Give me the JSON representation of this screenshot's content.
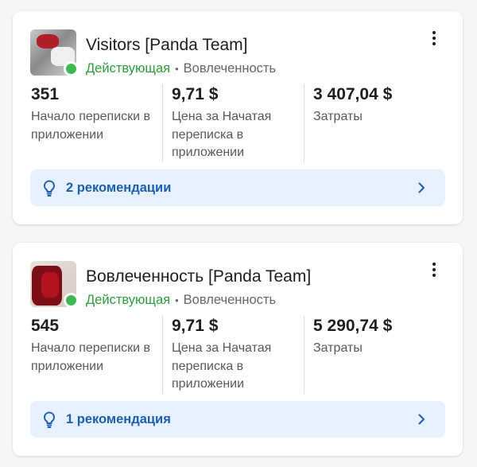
{
  "campaigns": [
    {
      "title": "Visitors [Panda Team]",
      "status": "Действующая",
      "separator": "•",
      "objective": "Вовлеченность",
      "metrics": [
        {
          "value": "351",
          "label": "Начало переписки в приложении"
        },
        {
          "value": "9,71 $",
          "label": "Цена за Начатая переписка в приложении"
        },
        {
          "value": "3 407,04 $",
          "label": "Затраты"
        }
      ],
      "recommendations": "2 рекомендации"
    },
    {
      "title": "Вовлеченность [Panda Team]",
      "status": "Действующая",
      "separator": "•",
      "objective": "Вовлеченность",
      "metrics": [
        {
          "value": "545",
          "label": "Начало переписки в приложении"
        },
        {
          "value": "9,71 $",
          "label": "Цена за Начатая переписка в приложении"
        },
        {
          "value": "5 290,74 $",
          "label": "Затраты"
        }
      ],
      "recommendations": "1 рекомендация"
    }
  ],
  "icons": {
    "thumbnail": "campaign-thumbnail",
    "status": "active-status-dot",
    "menu": "more-vertical-icon",
    "recommendation": "lightbulb-icon",
    "chevron": "chevron-right-icon"
  },
  "colors": {
    "status_active": "#2e9e3f",
    "status_dot": "#3fb950",
    "recommendation_bg": "#e7f1fd",
    "recommendation_text": "#1b5fae"
  }
}
